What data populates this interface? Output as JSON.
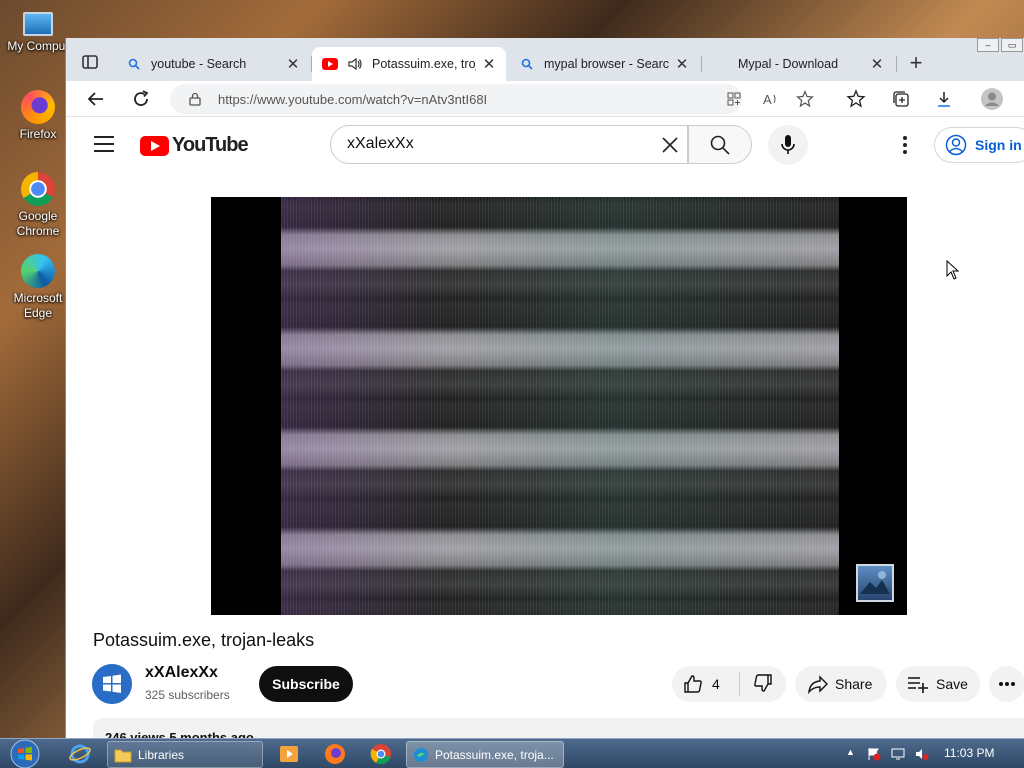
{
  "desktop": {
    "icons": [
      {
        "label": "My Comput",
        "icon": "computer-icon"
      },
      {
        "label": "Firefox",
        "icon": "firefox-icon"
      },
      {
        "label": "Google Chrome",
        "icon": "chrome-icon"
      },
      {
        "label": "Microsoft Edge",
        "icon": "edge-icon"
      }
    ]
  },
  "browser": {
    "tabs": [
      {
        "label": "youtube - Search",
        "favicon": "search-icon",
        "active": false
      },
      {
        "label": "Potassuim.exe, troja",
        "favicon": "youtube-icon",
        "active": true,
        "audio": true
      },
      {
        "label": "mypal browser - Search",
        "favicon": "search-icon",
        "active": false
      },
      {
        "label": "Mypal - Download",
        "favicon": "",
        "active": false
      }
    ],
    "url": "https://www.youtube.com/watch?v=nAtv3ntI68I"
  },
  "youtube": {
    "logo_text": "YouTube",
    "search_value": "xXalexXx",
    "signin_label": "Sign in",
    "video": {
      "title": "Potassuim.exe, trojan-leaks",
      "channel_name": "xXAlexXx",
      "subscribers": "325 subscribers",
      "subscribe_label": "Subscribe",
      "likes": "4",
      "share_label": "Share",
      "save_label": "Save",
      "description_preview": "246 views  5 months ago"
    }
  },
  "taskbar": {
    "items": [
      {
        "label": "Libraries",
        "icon": "folder-icon"
      },
      {
        "label": "Potassuim.exe, troja...",
        "icon": "edge-icon"
      }
    ],
    "clock": "11:03 PM"
  }
}
